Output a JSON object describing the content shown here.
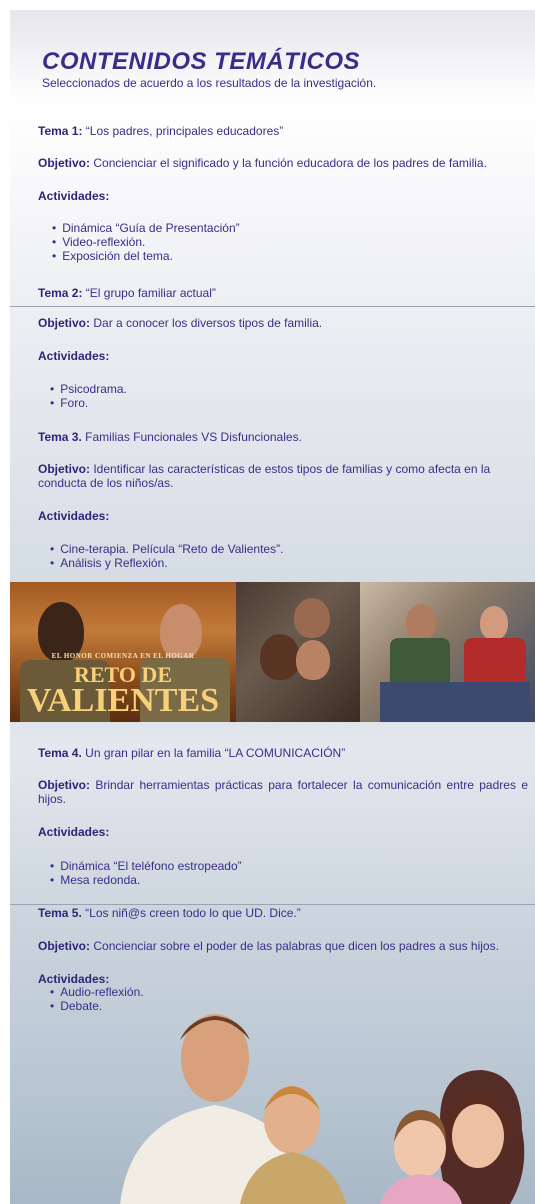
{
  "header": {
    "title": "CONTENIDOS TEMÁTICOS",
    "subtitle": "Seleccionados de acuerdo a los resultados de la investigación."
  },
  "topics": [
    {
      "tema_label": "Tema 1:",
      "tema_text": " “Los padres, principales educadores”",
      "obj_label": "Objetivo:",
      "obj_text": " Concienciar  el significado y la función educadora de los padres de familia.",
      "act_label": "Actividades:",
      "activities": [
        "Dinámica “Guía de Presentación”",
        "Video-reflexión.",
        "Exposición del tema."
      ]
    },
    {
      "tema_label": "Tema 2:",
      "tema_text": " “El grupo familiar actual”",
      "obj_label": "Objetivo:",
      "obj_text": " Dar a conocer los diversos tipos de familia.",
      "act_label": "Actividades:",
      "activities": [
        "Psicodrama.",
        "Foro."
      ]
    },
    {
      "tema_label": "Tema 3.",
      "tema_text": " Familias Funcionales VS Disfuncionales.",
      "obj_label": "Objetivo:",
      "obj_text": " Identificar las características de estos tipos de familias y como afecta en la conducta de los niños/as.",
      "act_label": "Actividades:",
      "activities": [
        "Cine-terapia.  Película “Reto de Valientes”.",
        "Análisis y Reflexión."
      ]
    },
    {
      "tema_label": "Tema 4.",
      "tema_text": " Un gran pilar en la familia “LA COMUNICACIÓN”",
      "obj_label": "Objetivo:",
      "obj_text": " Brindar herramientas prácticas para fortalecer la comunicación entre padres e hijos.",
      "act_label": "Actividades:",
      "activities": [
        "Dinámica “El teléfono estropeado”",
        "Mesa redonda."
      ]
    },
    {
      "tema_label": "Tema 5.",
      "tema_text": " “Los niñ@s  creen todo lo que UD. Dice.”",
      "obj_label": "Objetivo:",
      "obj_text": " Concienciar sobre el poder de las palabras que dicen los padres a sus hijos.",
      "act_label": "Actividades:",
      "activities": [
        "Audio-reflexión.",
        "Debate."
      ]
    }
  ],
  "movie_poster": {
    "tagline": "EL HONOR COMIENZA EN EL HOGAR",
    "title_line1": "RETO DE",
    "title_line2": "VALIENTES"
  },
  "colors": {
    "text": "#3a2d8a",
    "label": "#2f2478"
  }
}
